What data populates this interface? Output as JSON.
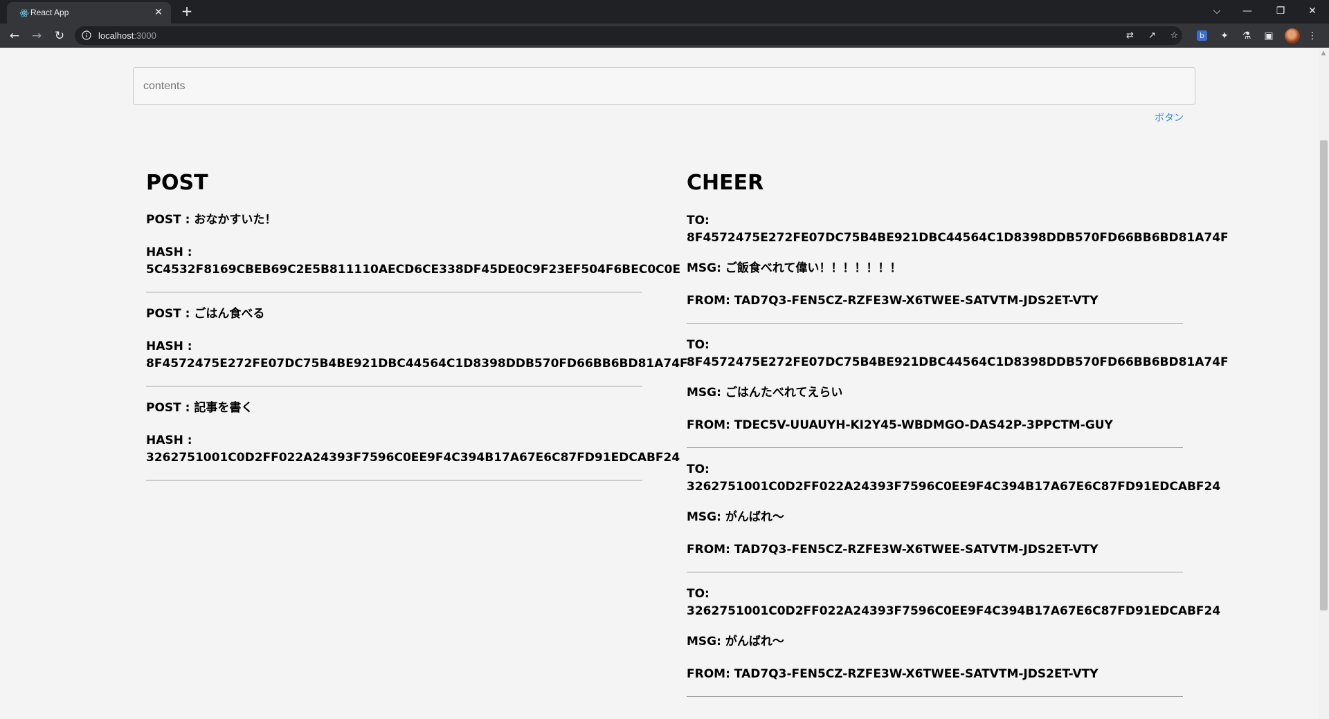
{
  "browser": {
    "tab_title": "React App",
    "tab_close": "✕",
    "new_tab": "+",
    "url_host": "localhost",
    "url_port": ":3000",
    "window_controls": {
      "tab_search": "⌵",
      "minimize": "—",
      "restore": "❐",
      "close": "✕"
    }
  },
  "form": {
    "input_placeholder": "contents",
    "input_value": "",
    "button_label": "ボタン"
  },
  "post": {
    "title": "POST",
    "items": [
      {
        "post": "POST : おなかすいた！",
        "hash_label": "HASH :",
        "hash": "5C4532F8169CBEB69C2E5B811110AECD6CE338DF45DE0C9F23EF504F6BEC0C0E"
      },
      {
        "post": "POST : ごはん食べる",
        "hash_label": "HASH :",
        "hash": "8F4572475E272FE07DC75B4BE921DBC44564C1D8398DDB570FD66BB6BD81A74F"
      },
      {
        "post": "POST : 記事を書く",
        "hash_label": "HASH :",
        "hash": "3262751001C0D2FF022A24393F7596C0EE9F4C394B17A67E6C87FD91EDCABF24"
      }
    ]
  },
  "cheer": {
    "title": "CHEER",
    "items": [
      {
        "to_label": "TO:",
        "to": "8F4572475E272FE07DC75B4BE921DBC44564C1D8398DDB570FD66BB6BD81A74F",
        "msg": "MSG: ご飯食べれて偉い！！！！！！！",
        "from": "FROM: TAD7Q3-FEN5CZ-RZFE3W-X6TWEE-SATVTM-JDS2ET-VTY"
      },
      {
        "to_label": "TO:",
        "to": "8F4572475E272FE07DC75B4BE921DBC44564C1D8398DDB570FD66BB6BD81A74F",
        "msg": "MSG: ごはんたべれてえらい",
        "from": "FROM: TDEC5V-UUAUYH-KI2Y45-WBDMGO-DAS42P-3PPCTM-GUY"
      },
      {
        "to_label": "TO:",
        "to": "3262751001C0D2FF022A24393F7596C0EE9F4C394B17A67E6C87FD91EDCABF24",
        "msg": "MSG: がんばれ〜",
        "from": "FROM: TAD7Q3-FEN5CZ-RZFE3W-X6TWEE-SATVTM-JDS2ET-VTY"
      },
      {
        "to_label": "TO:",
        "to": "3262751001C0D2FF022A24393F7596C0EE9F4C394B17A67E6C87FD91EDCABF24",
        "msg": "MSG: がんばれ〜",
        "from": "FROM: TAD7Q3-FEN5CZ-RZFE3W-X6TWEE-SATVTM-JDS2ET-VTY"
      }
    ]
  }
}
